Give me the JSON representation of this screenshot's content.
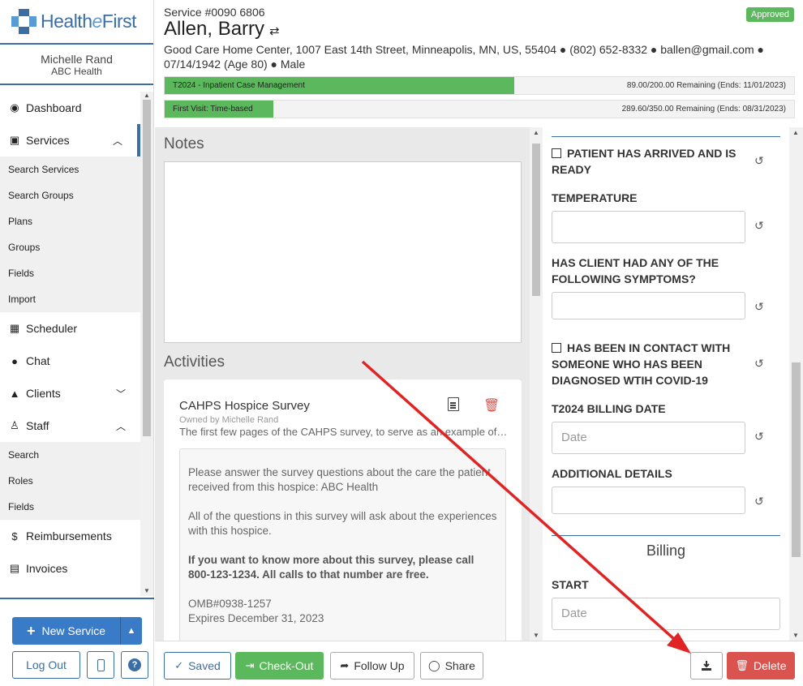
{
  "brand": {
    "name_part1": "Health",
    "name_italic": "e",
    "name_part2": "First"
  },
  "user": {
    "name": "Michelle Rand",
    "org": "ABC Health"
  },
  "nav": {
    "dashboard": "Dashboard",
    "services": "Services",
    "services_sub": [
      "Search Services",
      "Search Groups",
      "Plans",
      "Groups",
      "Fields",
      "Import"
    ],
    "scheduler": "Scheduler",
    "chat": "Chat",
    "clients": "Clients",
    "staff": "Staff",
    "staff_sub": [
      "Search",
      "Roles",
      "Fields"
    ],
    "reimbursements": "Reimbursements",
    "invoices": "Invoices"
  },
  "sidebar_bottom": {
    "new_service": "New Service",
    "logout": "Log Out"
  },
  "header": {
    "service_no": "Service #0090 6806",
    "patient_name": "Allen, Barry",
    "status": "Approved",
    "address_line": "Good Care Home Center, 1007 East 14th Street, Minneapolis, MN, US, 55404 ● (802) 652-8332 ● ballen@gmail.com ● 07/14/1942 (Age 80) ● Male",
    "bars": [
      {
        "label": "T2024 - Inpatient Case Management",
        "remaining": "89.00/200.00 Remaining (Ends: 11/01/2023)",
        "progress": 0.555
      },
      {
        "label": "First Visit: Time-based",
        "remaining": "289.60/350.00 Remaining (Ends: 08/31/2023)",
        "progress": 0.173
      }
    ]
  },
  "notes": {
    "title": "Notes",
    "value": ""
  },
  "activities": {
    "title": "Activities",
    "card": {
      "title": "CAHPS Hospice Survey",
      "owner": "Owned by Michelle Rand",
      "description": "The first few pages of the CAHPS survey, to serve as an example of a survey in the system.",
      "p1": "Please answer the survey questions about the care the patient received from this hospice: ABC Health",
      "p2": "All of the questions in this survey will ask about the experiences with this hospice.",
      "p3": "If you want to know more about this survey, please call 800-123-1234. All calls to that number are free.",
      "p4a": "OMB#0938-1257",
      "p4b": "Expires December 31, 2023"
    }
  },
  "form": {
    "arrived": "PATIENT HAS ARRIVED AND IS READY",
    "temperature": "TEMPERATURE",
    "symptoms": "HAS CLIENT HAD ANY OF THE FOLLOWING SYMPTOMS?",
    "contact": "HAS BEEN IN CONTACT WITH SOMEONE WHO HAS BEEN DIAGNOSED WTIH COVID-19",
    "billing_date": "T2024 BILLING DATE",
    "billing_date_placeholder": "Date",
    "additional": "ADDITIONAL DETAILS",
    "billing_section": "Billing",
    "start": "START",
    "start_placeholder": "Date"
  },
  "footer": {
    "saved": "Saved",
    "checkout": "Check-Out",
    "follow_up": "Follow Up",
    "share": "Share",
    "delete": "Delete"
  },
  "colors": {
    "primary": "#3a6ea5",
    "success": "#5cb85c",
    "danger": "#d9534f",
    "annotation": "#e02424"
  }
}
